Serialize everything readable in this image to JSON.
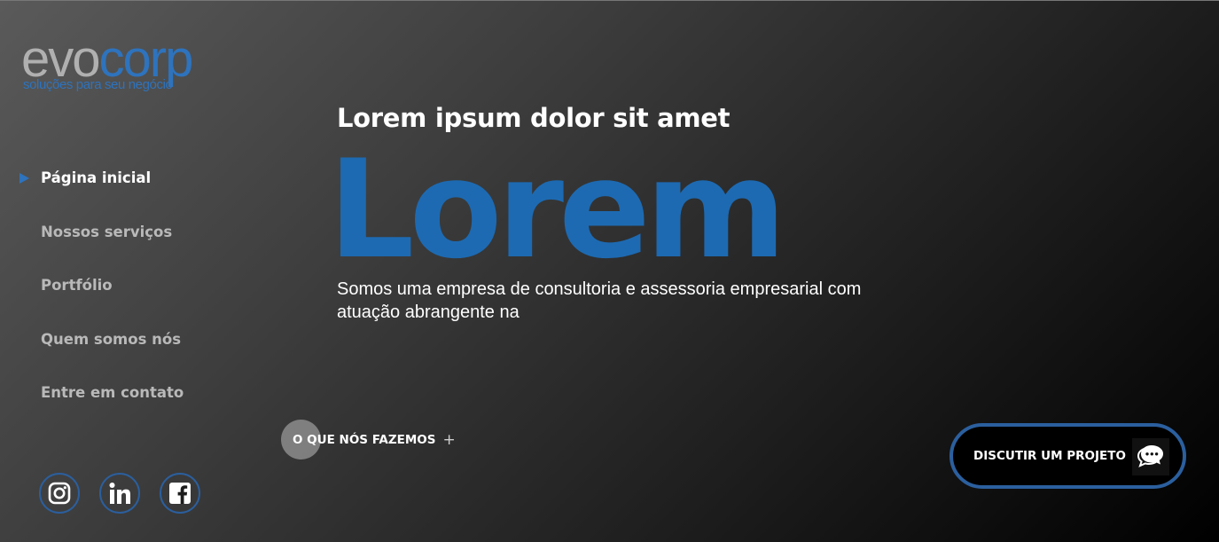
{
  "logo": {
    "evo": "evo",
    "corp": "corp",
    "tagline": "soluções para seu negócio"
  },
  "nav": {
    "items": [
      {
        "label": "Página inicial",
        "active": true
      },
      {
        "label": "Nossos serviços",
        "active": false
      },
      {
        "label": "Portfólio",
        "active": false
      },
      {
        "label": "Quem somos nós",
        "active": false
      },
      {
        "label": "Entre em contato",
        "active": false
      }
    ]
  },
  "social": [
    {
      "name": "instagram-icon"
    },
    {
      "name": "linkedin-icon"
    },
    {
      "name": "facebook-icon"
    }
  ],
  "hero": {
    "subtitle": "Lorem ipsum dolor sit amet",
    "headline": "Lorem",
    "description": "Somos uma empresa de consultoria e assessoria empresarial com atuação abrangente na"
  },
  "actions": {
    "what_we_do": "O QUE NÓS FAZEMOS",
    "what_we_do_icon": "+",
    "discuss_project": "DISCUTIR UM PROJETO"
  },
  "colors": {
    "accent": "#1d6ab2",
    "ring": "#2b5f9e",
    "logo_grey": "#b0b0b0"
  }
}
